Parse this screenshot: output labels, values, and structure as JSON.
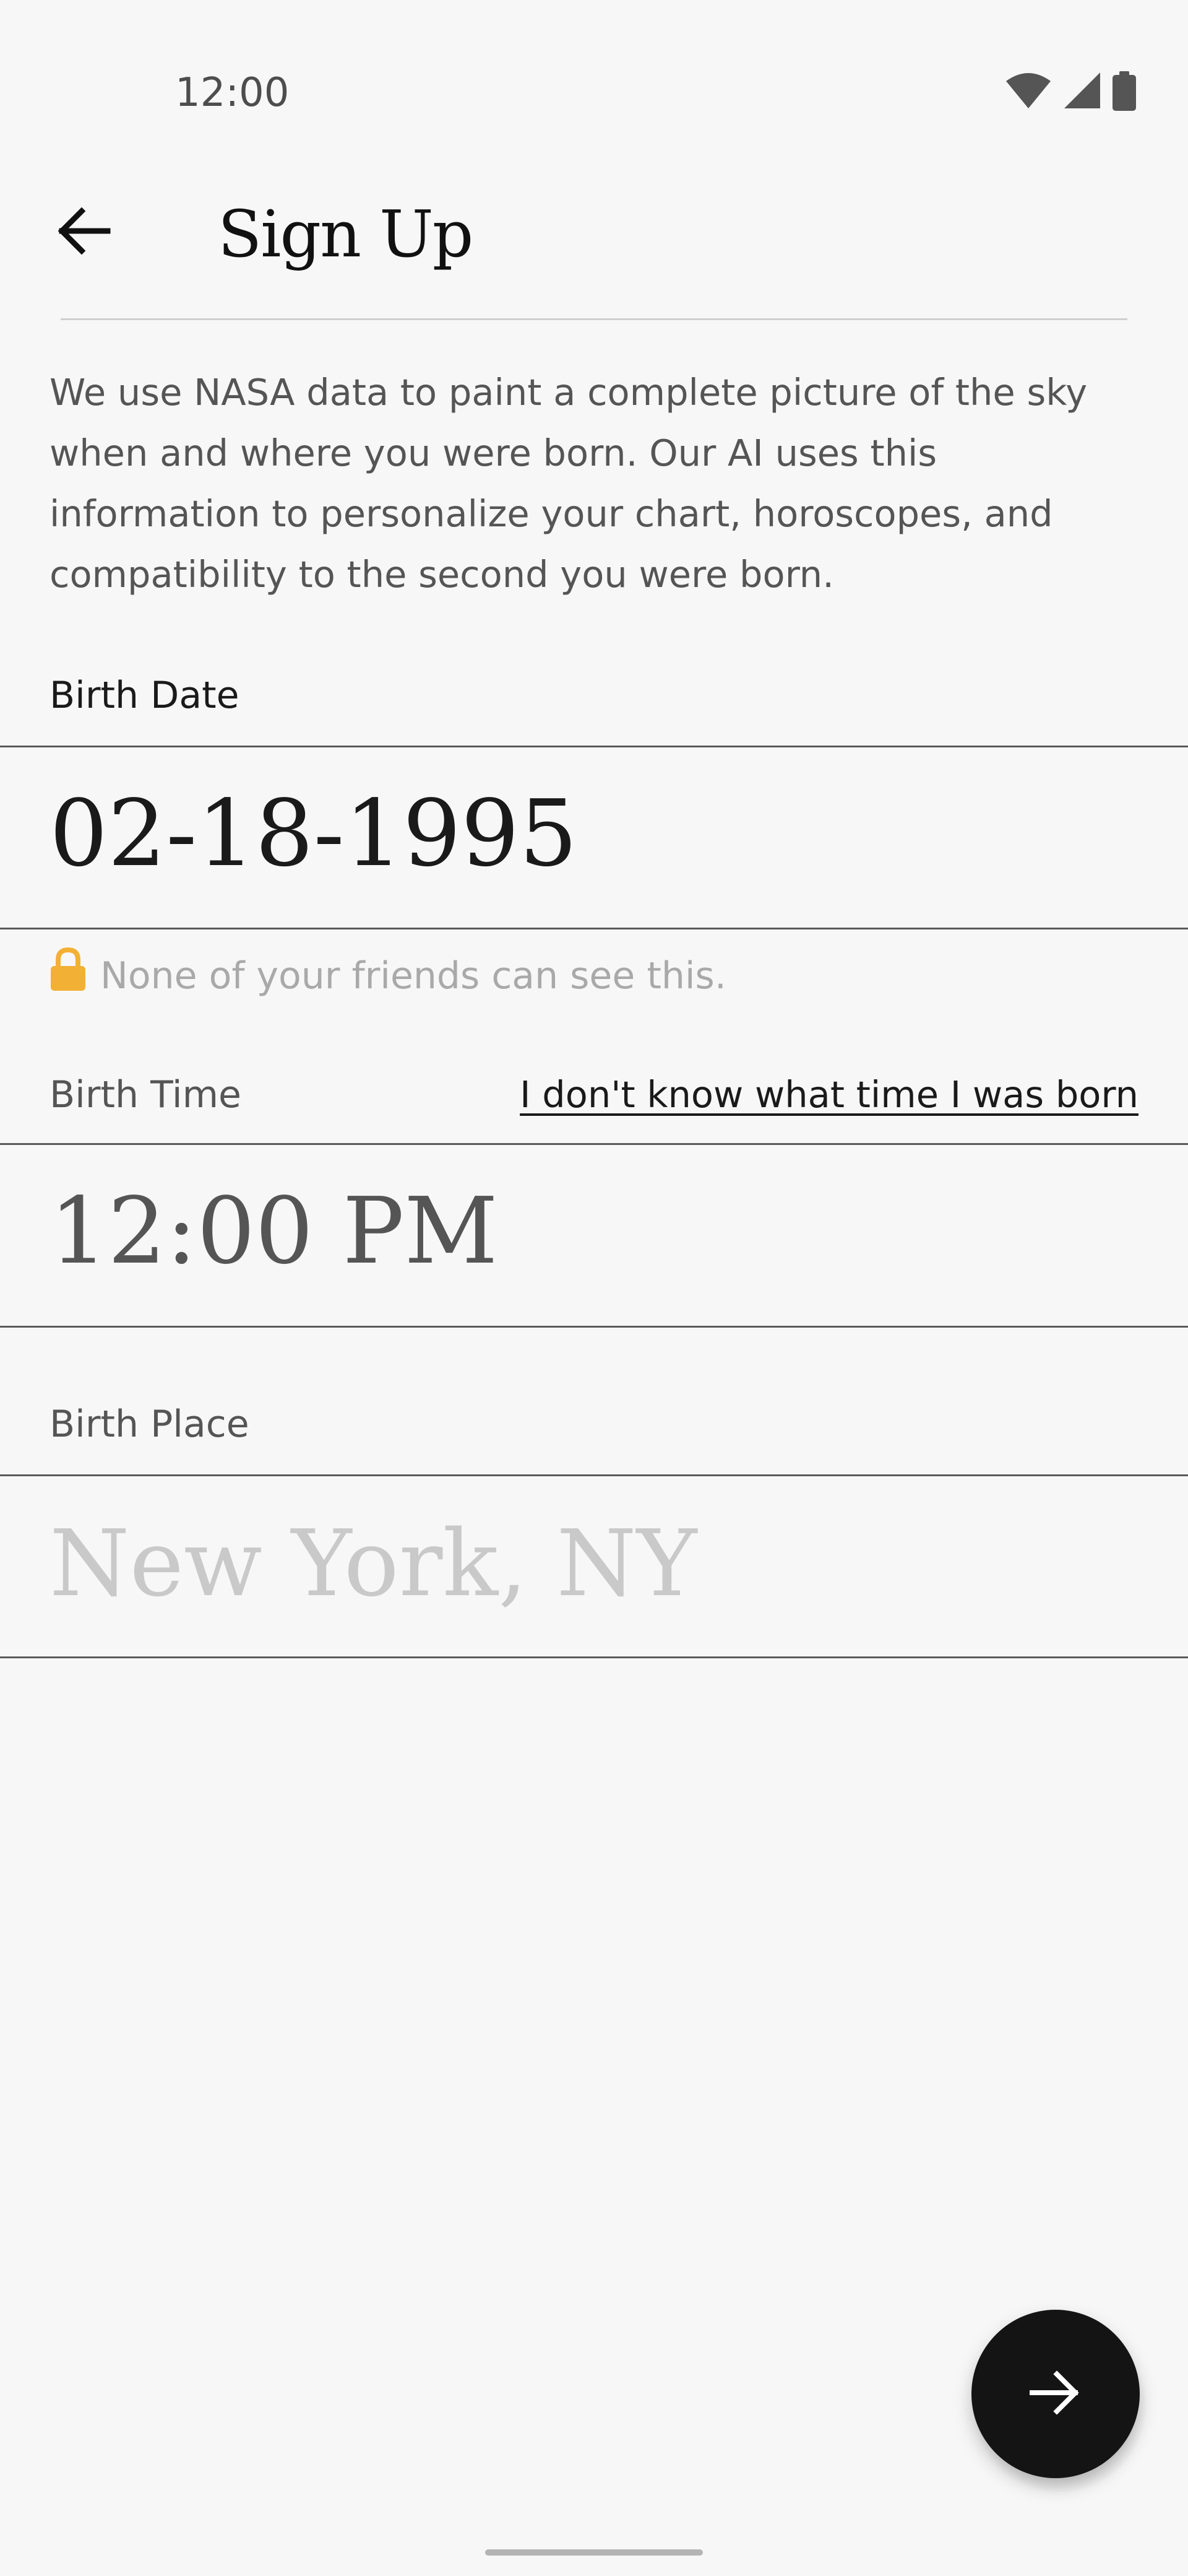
{
  "status_bar": {
    "time": "12:00",
    "icons": [
      "wifi-icon",
      "cellular-signal-icon",
      "battery-icon"
    ]
  },
  "header": {
    "back_icon": "arrow-left-icon",
    "title": "Sign Up"
  },
  "intro": {
    "text": "We use NASA data to paint a complete picture of the sky when and where you were born. Our AI uses this information to personalize your chart, horoscopes, and compatibility to the second you were born."
  },
  "birth_date": {
    "label": "Birth Date",
    "value": "02-18-1995",
    "privacy_icon": "lock-icon",
    "privacy_note": "None of your friends can see this."
  },
  "birth_time": {
    "label": "Birth Time",
    "unknown_link": "I don't know what time I was born",
    "value": "12:00 PM"
  },
  "birth_place": {
    "label": "Birth Place",
    "placeholder": "New York, NY"
  },
  "fab": {
    "icon": "arrow-right-icon"
  },
  "colors": {
    "background": "#f7f7f7",
    "fab": "#141414",
    "lock": "#f2b035",
    "placeholder": "#c9c9c9",
    "muted_text": "#555555"
  }
}
